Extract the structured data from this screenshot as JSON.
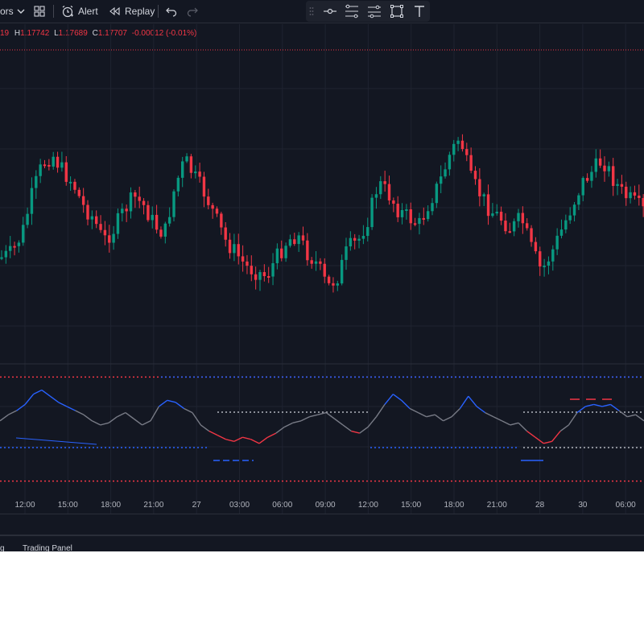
{
  "toolbar": {
    "indicators_label": "ors",
    "alert_label": "Alert",
    "replay_label": "Replay"
  },
  "symbol_info": {
    "prefix": "19",
    "high_label": "H",
    "high": "1.17742",
    "low_label": "L",
    "low": "1.17689",
    "close_label": "C",
    "close": "1.17707",
    "change": "-0.00012 (-0.01%)"
  },
  "time_axis": {
    "labels": [
      "12:00",
      "15:00",
      "18:00",
      "21:00",
      "27",
      "03:00",
      "06:00",
      "09:00",
      "12:00",
      "15:00",
      "18:00",
      "21:00",
      "28",
      "30",
      "06:00"
    ]
  },
  "bottom_panel": {
    "tabs": [
      "g",
      "Trading Panel"
    ]
  },
  "colors": {
    "background": "#131722",
    "up_candle": "#089981",
    "down_candle": "#f23645",
    "oscillator_neutral": "#787b86",
    "oscillator_overbought": "#2962ff",
    "oscillator_oversold": "#f23645",
    "level_line": "#b2b5be"
  },
  "chart_data": {
    "type": "candlestick",
    "symbol_last": {
      "high": 1.17742,
      "low": 1.17689,
      "close": 1.17707,
      "change": -0.00012,
      "change_pct": -0.01
    },
    "price_series_shape": [
      0.62,
      0.6,
      0.52,
      0.35,
      0.22,
      0.18,
      0.25,
      0.3,
      0.4,
      0.45,
      0.55,
      0.5,
      0.42,
      0.36,
      0.4,
      0.48,
      0.52,
      0.32,
      0.2,
      0.28,
      0.35,
      0.45,
      0.55,
      0.6,
      0.66,
      0.68,
      0.7,
      0.62,
      0.55,
      0.52,
      0.6,
      0.65,
      0.75,
      0.7,
      0.58,
      0.55,
      0.45,
      0.3,
      0.35,
      0.42,
      0.45,
      0.48,
      0.38,
      0.3,
      0.18,
      0.1,
      0.28,
      0.35,
      0.42,
      0.45,
      0.5,
      0.45,
      0.58,
      0.68,
      0.6,
      0.5,
      0.4,
      0.3,
      0.25,
      0.2,
      0.28,
      0.35,
      0.38,
      0.42
    ],
    "oscillator": {
      "values": [
        0.2,
        0.35,
        0.45,
        0.6,
        0.85,
        0.95,
        0.8,
        0.65,
        0.55,
        0.45,
        0.35,
        0.2,
        0.1,
        0.15,
        0.3,
        0.4,
        0.25,
        0.1,
        0.2,
        0.55,
        0.7,
        0.65,
        0.5,
        0.4,
        0.1,
        -0.05,
        -0.15,
        -0.25,
        -0.3,
        -0.2,
        -0.25,
        -0.35,
        -0.2,
        -0.1,
        0.05,
        0.15,
        0.2,
        0.3,
        0.35,
        0.4,
        0.25,
        0.1,
        -0.05,
        -0.1,
        0.05,
        0.3,
        0.6,
        0.85,
        0.7,
        0.5,
        0.4,
        0.3,
        0.35,
        0.2,
        0.3,
        0.5,
        0.8,
        0.55,
        0.4,
        0.3,
        0.2,
        0.1,
        0.15,
        -0.05,
        -0.2,
        -0.35,
        -0.3,
        -0.05,
        0.1,
        0.4,
        0.55,
        0.6,
        0.55,
        0.6,
        0.45,
        0.3,
        0.35,
        0.2
      ],
      "upper_band": 0.95,
      "lower_band": -0.95
    }
  }
}
